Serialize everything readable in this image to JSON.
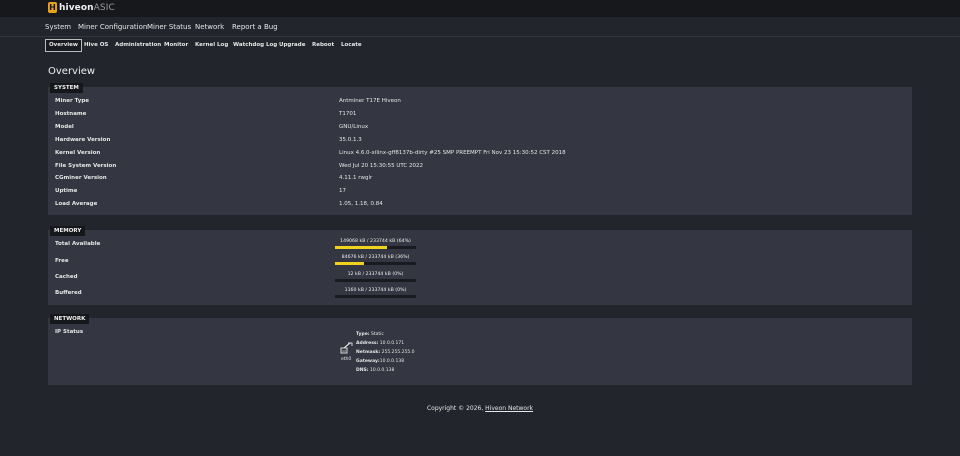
{
  "brand": {
    "logo_letter": "H",
    "name_bold": "hiveon",
    "name_light": "ASIC"
  },
  "main_nav": [
    "System",
    "Miner Configuration",
    "Miner Status",
    "Network",
    "Report a Bug"
  ],
  "sub_nav": [
    "Overview",
    "Hive OS",
    "Administration",
    "Monitor",
    "Kernel Log",
    "Watchdog Log",
    "Upgrade",
    "Reboot",
    "Locate"
  ],
  "page_title": "Overview",
  "system": {
    "legend": "SYSTEM",
    "rows": [
      {
        "label": "Miner Type",
        "value": "Antminer T17E Hiveon"
      },
      {
        "label": "Hostname",
        "value": "T1701"
      },
      {
        "label": "Model",
        "value": "GNU/Linux"
      },
      {
        "label": "Hardware Version",
        "value": "35.0.1.3"
      },
      {
        "label": "Kernel Version",
        "value": "Linux 4.6.0-xilinx-gff8137b-dirty #25 SMP PREEMPT Fri Nov 23 15:30:52 CST 2018"
      },
      {
        "label": "File System Version",
        "value": "Wed Jul 20 15:30:55 UTC 2022"
      },
      {
        "label": "CGminer Version",
        "value": "4.11.1 rwglr"
      },
      {
        "label": "Uptime",
        "value": "17"
      },
      {
        "label": "Load Average",
        "value": "1.05, 1.18, 0.84"
      }
    ]
  },
  "memory": {
    "legend": "MEMORY",
    "bar_color": "#f2d31b",
    "rows": [
      {
        "label": "Total Available",
        "text": "149068 kB / 233744 kB (64%)",
        "fraction": 0.64
      },
      {
        "label": "Free",
        "text": "84676 kB / 233744 kB (36%)",
        "fraction": 0.36
      },
      {
        "label": "Cached",
        "text": "12 kB / 233744 kB (0%)",
        "fraction": 0.0
      },
      {
        "label": "Buffered",
        "text": "1160 kB / 233744 kB (0%)",
        "fraction": 0.0
      }
    ]
  },
  "network": {
    "legend": "NETWORK",
    "ip_status_label": "IP Status",
    "icon": "network-port-icon",
    "interface": "eth0",
    "details": [
      {
        "key": "Type:",
        "value": " Static"
      },
      {
        "key": "Address:",
        "value": " 10.0.0.171"
      },
      {
        "key": "Netmask:",
        "value": " 255.255.255.0"
      },
      {
        "key": "Gateway:",
        "value": "10.0.0.138"
      },
      {
        "key": "DNS:",
        "value": " 10.0.0.138"
      }
    ]
  },
  "footer": {
    "text": "Copyright © 2026, ",
    "link": "Hiveon Network"
  }
}
